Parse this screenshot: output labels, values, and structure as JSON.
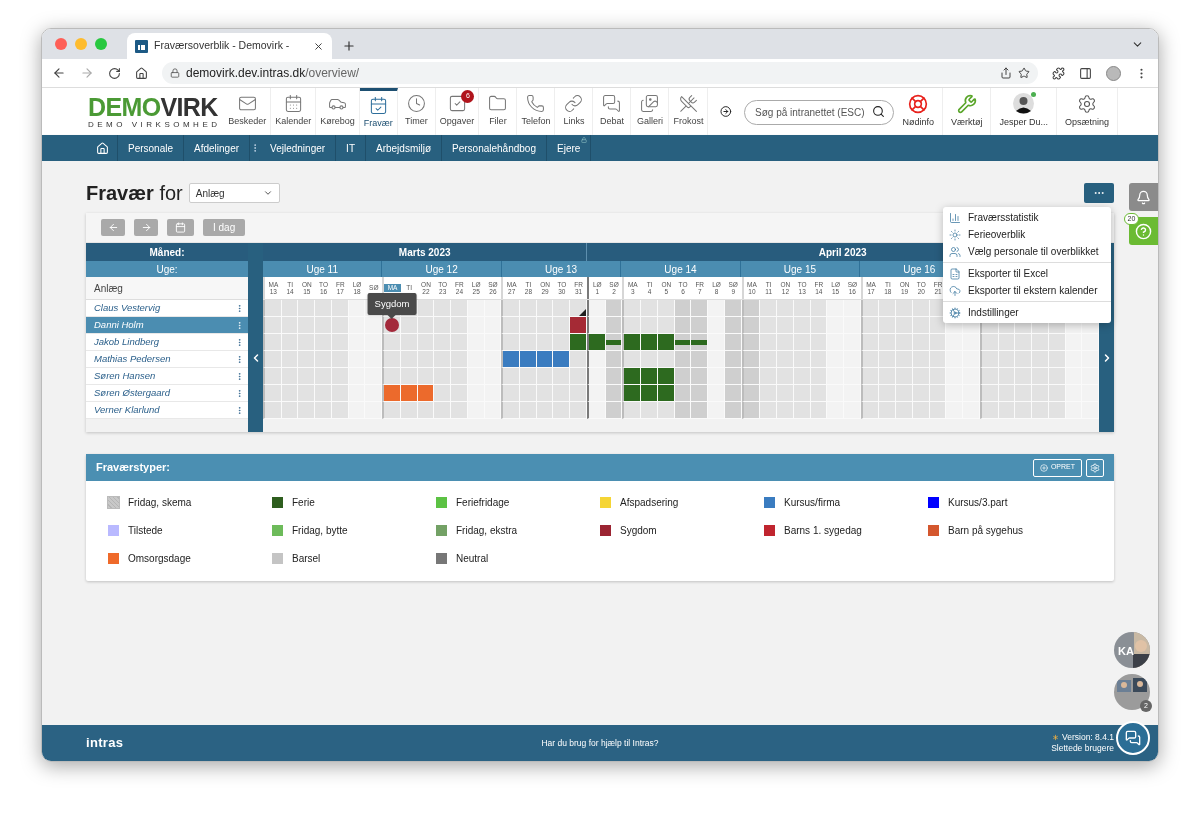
{
  "browser": {
    "tab_title": "Fraværsoverblik - Demovirk -",
    "url_host": "demovirk.dev.intras.dk",
    "url_path": "/overview/"
  },
  "header": {
    "logo": {
      "part_1": "DEMO",
      "part_2": "VIRK",
      "subtitle": "DEMO VIRKSOMHED"
    },
    "apps": [
      {
        "label": "Beskeder",
        "kind": "mail",
        "selected": false
      },
      {
        "label": "Kalender",
        "kind": "calendar",
        "selected": false
      },
      {
        "label": "Kørebog",
        "kind": "car",
        "selected": false
      },
      {
        "label": "Fravær",
        "kind": "absence",
        "selected": true
      },
      {
        "label": "Timer",
        "kind": "clock",
        "selected": false
      },
      {
        "label": "Opgaver",
        "kind": "tasks",
        "selected": false,
        "badge": "6"
      },
      {
        "label": "Filer",
        "kind": "folder",
        "selected": false
      },
      {
        "label": "Telefon",
        "kind": "phone",
        "selected": false
      },
      {
        "label": "Links",
        "kind": "link",
        "selected": false
      },
      {
        "label": "Debat",
        "kind": "chat",
        "selected": false
      },
      {
        "label": "Galleri",
        "kind": "gallery",
        "selected": false
      },
      {
        "label": "Frokost",
        "kind": "lunch",
        "selected": false
      }
    ],
    "search": {
      "placeholder": "Søg på intranettet (ESC)"
    },
    "tools": [
      {
        "label": "Nødinfo",
        "kind": "lifebuoy"
      },
      {
        "label": "Værktøj",
        "kind": "tools"
      },
      {
        "label": "Jesper Du...",
        "kind": "avatar",
        "online": true
      },
      {
        "label": "Opsætning",
        "kind": "cogs"
      }
    ]
  },
  "nav": [
    {
      "label": "Personale",
      "kind": "plain"
    },
    {
      "label": "Afdelinger",
      "kind": "more"
    },
    {
      "label": "Vejledninger",
      "kind": "plain"
    },
    {
      "label": "IT",
      "kind": "plain"
    },
    {
      "label": "Arbejdsmiljø",
      "kind": "plain"
    },
    {
      "label": "Personalehåndbog",
      "kind": "plain"
    },
    {
      "label": "Ejere",
      "kind": "locked"
    }
  ],
  "page": {
    "title": "Fravær",
    "title_suffix": "for",
    "department": "Anlæg"
  },
  "toolbar": {
    "today": "I dag"
  },
  "calendar": {
    "month_heading": "Måned:",
    "week_heading": "Uge:",
    "group": "Anlæg",
    "months": [
      "Marts 2023",
      "April 2023"
    ],
    "weeks": [
      "Uge 11",
      "Uge 12",
      "Uge 13",
      "Uge 14",
      "Uge 15",
      "Uge 16"
    ],
    "days": [
      {
        "dow": "MA",
        "date": "13",
        "kind": "weekday",
        "week_start": true,
        "month_start": false,
        "highlighted": false
      },
      {
        "dow": "TI",
        "date": "14",
        "kind": "weekday",
        "week_start": false,
        "month_start": false,
        "highlighted": false
      },
      {
        "dow": "ON",
        "date": "15",
        "kind": "weekday",
        "week_start": false,
        "month_start": false,
        "highlighted": false
      },
      {
        "dow": "TO",
        "date": "16",
        "kind": "weekday",
        "week_start": false,
        "month_start": false,
        "highlighted": false
      },
      {
        "dow": "FR",
        "date": "17",
        "kind": "weekday",
        "week_start": false,
        "month_start": false,
        "highlighted": false
      },
      {
        "dow": "LØ",
        "date": "18",
        "kind": "weekend",
        "week_start": false,
        "month_start": false,
        "highlighted": false
      },
      {
        "dow": "SØ",
        "kind": "weekend",
        "week_start": false,
        "month_start": false,
        "highlighted": false
      },
      {
        "dow": "MA",
        "kind": "weekday",
        "week_start": true,
        "month_start": false,
        "highlighted": true
      },
      {
        "dow": "TI",
        "kind": "weekday",
        "week_start": false,
        "month_start": false,
        "highlighted": false
      },
      {
        "dow": "ON",
        "date": "22",
        "kind": "weekday",
        "week_start": false,
        "month_start": false,
        "highlighted": false
      },
      {
        "dow": "TO",
        "date": "23",
        "kind": "weekday",
        "week_start": false,
        "month_start": false,
        "highlighted": false
      },
      {
        "dow": "FR",
        "date": "24",
        "kind": "weekday",
        "week_start": false,
        "month_start": false,
        "highlighted": false
      },
      {
        "dow": "LØ",
        "date": "25",
        "kind": "weekend",
        "week_start": false,
        "month_start": false,
        "highlighted": false
      },
      {
        "dow": "SØ",
        "date": "26",
        "kind": "weekend",
        "week_start": false,
        "month_start": false,
        "highlighted": false
      },
      {
        "dow": "MA",
        "date": "27",
        "kind": "weekday",
        "week_start": true,
        "month_start": false,
        "highlighted": false
      },
      {
        "dow": "TI",
        "date": "28",
        "kind": "weekday",
        "week_start": false,
        "month_start": false,
        "highlighted": false
      },
      {
        "dow": "ON",
        "date": "29",
        "kind": "weekday",
        "week_start": false,
        "month_start": false,
        "highlighted": false
      },
      {
        "dow": "TO",
        "date": "30",
        "kind": "weekday",
        "week_start": false,
        "month_start": false,
        "highlighted": false
      },
      {
        "dow": "FR",
        "date": "31",
        "kind": "weekday",
        "week_start": false,
        "month_start": false,
        "highlighted": false
      },
      {
        "dow": "LØ",
        "date": "1",
        "kind": "weekend",
        "week_start": false,
        "month_start": true,
        "highlighted": false
      },
      {
        "dow": "SØ",
        "date": "2",
        "kind": "holiday",
        "week_start": false,
        "month_start": false,
        "highlighted": false
      },
      {
        "dow": "MA",
        "date": "3",
        "kind": "weekday",
        "week_start": true,
        "month_start": false,
        "highlighted": false
      },
      {
        "dow": "TI",
        "date": "4",
        "kind": "weekday",
        "week_start": false,
        "month_start": false,
        "highlighted": false
      },
      {
        "dow": "ON",
        "date": "5",
        "kind": "weekday",
        "week_start": false,
        "month_start": false,
        "highlighted": false
      },
      {
        "dow": "TO",
        "date": "6",
        "kind": "holiday",
        "week_start": false,
        "month_start": false,
        "highlighted": false
      },
      {
        "dow": "FR",
        "date": "7",
        "kind": "holiday",
        "week_start": false,
        "month_start": false,
        "highlighted": false
      },
      {
        "dow": "LØ",
        "date": "8",
        "kind": "weekend",
        "week_start": false,
        "month_start": false,
        "highlighted": false
      },
      {
        "dow": "SØ",
        "date": "9",
        "kind": "holiday",
        "week_start": false,
        "month_start": false,
        "highlighted": false
      },
      {
        "dow": "MA",
        "date": "10",
        "kind": "holiday",
        "week_start": true,
        "month_start": false,
        "highlighted": false
      },
      {
        "dow": "TI",
        "date": "11",
        "kind": "weekday",
        "week_start": false,
        "month_start": false,
        "highlighted": false
      },
      {
        "dow": "ON",
        "date": "12",
        "kind": "weekday",
        "week_start": false,
        "month_start": false,
        "highlighted": false
      },
      {
        "dow": "TO",
        "date": "13",
        "kind": "weekday",
        "week_start": false,
        "month_start": false,
        "highlighted": false
      },
      {
        "dow": "FR",
        "date": "14",
        "kind": "weekday",
        "week_start": false,
        "month_start": false,
        "highlighted": false
      },
      {
        "dow": "LØ",
        "date": "15",
        "kind": "weekend",
        "week_start": false,
        "month_start": false,
        "highlighted": false
      },
      {
        "dow": "SØ",
        "date": "16",
        "kind": "weekend",
        "week_start": false,
        "month_start": false,
        "highlighted": false
      },
      {
        "dow": "MA",
        "date": "17",
        "kind": "weekday",
        "week_start": true,
        "month_start": false,
        "highlighted": false
      },
      {
        "dow": "TI",
        "date": "18",
        "kind": "weekday",
        "week_start": false,
        "month_start": false,
        "highlighted": false
      },
      {
        "dow": "ON",
        "date": "19",
        "kind": "weekday",
        "week_start": false,
        "month_start": false,
        "highlighted": false
      },
      {
        "dow": "TO",
        "date": "20",
        "kind": "weekday",
        "week_start": false,
        "month_start": false,
        "highlighted": false
      },
      {
        "dow": "FR",
        "date": "21",
        "kind": "weekday",
        "week_start": false,
        "month_start": false,
        "highlighted": false
      },
      {
        "kind": "weekend",
        "week_start": false,
        "month_start": false
      },
      {
        "kind": "weekend",
        "week_start": false,
        "month_start": false
      },
      {
        "kind": "weekday",
        "week_start": true,
        "month_start": false
      },
      {
        "kind": "weekday",
        "week_start": false,
        "month_start": false
      },
      {
        "kind": "weekday",
        "week_start": false,
        "month_start": false
      },
      {
        "kind": "weekday",
        "week_start": false,
        "month_start": false
      },
      {
        "kind": "weekday",
        "week_start": false,
        "month_start": false
      },
      {
        "kind": "weekend",
        "week_start": false,
        "month_start": false
      },
      {
        "kind": "weekend",
        "week_start": false,
        "month_start": false
      }
    ],
    "employees": [
      {
        "name": "Claus Vestervig",
        "selected": false,
        "cells": [
          {
            "kind": "none"
          },
          {
            "kind": "none"
          },
          {
            "kind": "none"
          },
          {
            "kind": "none"
          },
          {
            "kind": "none"
          },
          {
            "kind": "none"
          },
          {
            "kind": "none"
          },
          {
            "kind": "none"
          },
          {
            "kind": "none"
          },
          {
            "kind": "none"
          },
          {
            "kind": "none"
          },
          {
            "kind": "none"
          },
          {
            "kind": "none"
          },
          {
            "kind": "none"
          },
          {
            "kind": "none"
          },
          {
            "kind": "none"
          },
          {
            "kind": "none"
          },
          {
            "kind": "none"
          },
          {
            "kind": "marker",
            "color": "#1f1f1f"
          },
          {
            "kind": "none"
          },
          {
            "kind": "none"
          },
          {
            "kind": "none"
          },
          {
            "kind": "none"
          },
          {
            "kind": "none"
          },
          {
            "kind": "none"
          },
          {
            "kind": "none"
          },
          {
            "kind": "none"
          },
          {
            "kind": "none"
          },
          {
            "kind": "none"
          },
          {
            "kind": "none"
          },
          {
            "kind": "none"
          },
          {
            "kind": "none"
          },
          {
            "kind": "none"
          },
          {
            "kind": "none"
          },
          {
            "kind": "none"
          },
          {
            "kind": "none"
          },
          {
            "kind": "none"
          },
          {
            "kind": "none"
          },
          {
            "kind": "none"
          },
          {
            "kind": "none"
          },
          {
            "kind": "none"
          },
          {
            "kind": "none"
          },
          {
            "kind": "none"
          },
          {
            "kind": "none"
          },
          {
            "kind": "none"
          },
          {
            "kind": "none"
          },
          {
            "kind": "none"
          },
          {
            "kind": "none"
          },
          {
            "kind": "none"
          }
        ]
      },
      {
        "name": "Danni Holm",
        "selected": true,
        "cells": [
          {
            "kind": "none"
          },
          {
            "kind": "none"
          },
          {
            "kind": "none"
          },
          {
            "kind": "none"
          },
          {
            "kind": "none"
          },
          {
            "kind": "none"
          },
          {
            "kind": "none"
          },
          {
            "kind": "dot",
            "color": "#a3283a",
            "tooltip": "Sygdom"
          },
          {
            "kind": "none"
          },
          {
            "kind": "none"
          },
          {
            "kind": "none"
          },
          {
            "kind": "none"
          },
          {
            "kind": "none"
          },
          {
            "kind": "none"
          },
          {
            "kind": "none"
          },
          {
            "kind": "none"
          },
          {
            "kind": "none"
          },
          {
            "kind": "none"
          },
          {
            "kind": "full",
            "color": "#a52a35"
          },
          {
            "kind": "none"
          },
          {
            "kind": "none"
          },
          {
            "kind": "none"
          },
          {
            "kind": "none"
          },
          {
            "kind": "none"
          },
          {
            "kind": "none"
          },
          {
            "kind": "none"
          },
          {
            "kind": "none"
          },
          {
            "kind": "none"
          },
          {
            "kind": "none"
          },
          {
            "kind": "none"
          },
          {
            "kind": "none"
          },
          {
            "kind": "none"
          },
          {
            "kind": "none"
          },
          {
            "kind": "none"
          },
          {
            "kind": "none"
          },
          {
            "kind": "none"
          },
          {
            "kind": "none"
          },
          {
            "kind": "none"
          },
          {
            "kind": "none"
          },
          {
            "kind": "none"
          },
          {
            "kind": "none"
          },
          {
            "kind": "none"
          },
          {
            "kind": "none"
          },
          {
            "kind": "none"
          },
          {
            "kind": "none"
          },
          {
            "kind": "none"
          },
          {
            "kind": "none"
          },
          {
            "kind": "none"
          },
          {
            "kind": "none"
          }
        ]
      },
      {
        "name": "Jakob Lindberg",
        "selected": false,
        "cells": [
          {
            "kind": "none"
          },
          {
            "kind": "none"
          },
          {
            "kind": "none"
          },
          {
            "kind": "none"
          },
          {
            "kind": "none"
          },
          {
            "kind": "none"
          },
          {
            "kind": "none"
          },
          {
            "kind": "none"
          },
          {
            "kind": "none"
          },
          {
            "kind": "none"
          },
          {
            "kind": "none"
          },
          {
            "kind": "none"
          },
          {
            "kind": "none"
          },
          {
            "kind": "none"
          },
          {
            "kind": "none"
          },
          {
            "kind": "none"
          },
          {
            "kind": "none"
          },
          {
            "kind": "none"
          },
          {
            "kind": "full",
            "color": "#2d6a1f"
          },
          {
            "kind": "full",
            "color": "#2d6a1f"
          },
          {
            "kind": "half",
            "color": "#2d6a1f"
          },
          {
            "kind": "full",
            "color": "#2d6a1f"
          },
          {
            "kind": "full",
            "color": "#2d6a1f"
          },
          {
            "kind": "full",
            "color": "#2d6a1f"
          },
          {
            "kind": "half",
            "color": "#2d6a1f"
          },
          {
            "kind": "half",
            "color": "#2d6a1f"
          },
          {
            "kind": "none"
          },
          {
            "kind": "none"
          },
          {
            "kind": "none"
          },
          {
            "kind": "none"
          },
          {
            "kind": "none"
          },
          {
            "kind": "none"
          },
          {
            "kind": "none"
          },
          {
            "kind": "none"
          },
          {
            "kind": "none"
          },
          {
            "kind": "none"
          },
          {
            "kind": "none"
          },
          {
            "kind": "none"
          },
          {
            "kind": "none"
          },
          {
            "kind": "none"
          },
          {
            "kind": "none"
          },
          {
            "kind": "none"
          },
          {
            "kind": "none"
          },
          {
            "kind": "none"
          },
          {
            "kind": "none"
          },
          {
            "kind": "none"
          },
          {
            "kind": "none"
          },
          {
            "kind": "none"
          },
          {
            "kind": "none"
          }
        ]
      },
      {
        "name": "Mathias Pedersen",
        "selected": false,
        "cells": [
          {
            "kind": "none"
          },
          {
            "kind": "none"
          },
          {
            "kind": "none"
          },
          {
            "kind": "none"
          },
          {
            "kind": "none"
          },
          {
            "kind": "none"
          },
          {
            "kind": "none"
          },
          {
            "kind": "none"
          },
          {
            "kind": "none"
          },
          {
            "kind": "none"
          },
          {
            "kind": "none"
          },
          {
            "kind": "none"
          },
          {
            "kind": "none"
          },
          {
            "kind": "none"
          },
          {
            "kind": "full",
            "color": "#3a7cc0"
          },
          {
            "kind": "full",
            "color": "#3a7cc0"
          },
          {
            "kind": "full",
            "color": "#3a7cc0"
          },
          {
            "kind": "full",
            "color": "#3a7cc0"
          },
          {
            "kind": "none"
          },
          {
            "kind": "none"
          },
          {
            "kind": "none"
          },
          {
            "kind": "none"
          },
          {
            "kind": "none"
          },
          {
            "kind": "none"
          },
          {
            "kind": "none"
          },
          {
            "kind": "none"
          },
          {
            "kind": "none"
          },
          {
            "kind": "none"
          },
          {
            "kind": "none"
          },
          {
            "kind": "none"
          },
          {
            "kind": "none"
          },
          {
            "kind": "none"
          },
          {
            "kind": "none"
          },
          {
            "kind": "none"
          },
          {
            "kind": "none"
          },
          {
            "kind": "none"
          },
          {
            "kind": "none"
          },
          {
            "kind": "none"
          },
          {
            "kind": "none"
          },
          {
            "kind": "none"
          },
          {
            "kind": "none"
          },
          {
            "kind": "none"
          },
          {
            "kind": "none"
          },
          {
            "kind": "none"
          },
          {
            "kind": "none"
          },
          {
            "kind": "none"
          },
          {
            "kind": "none"
          },
          {
            "kind": "none"
          },
          {
            "kind": "none"
          }
        ]
      },
      {
        "name": "Søren Hansen",
        "selected": false,
        "cells": [
          {
            "kind": "none"
          },
          {
            "kind": "none"
          },
          {
            "kind": "none"
          },
          {
            "kind": "none"
          },
          {
            "kind": "none"
          },
          {
            "kind": "none"
          },
          {
            "kind": "none"
          },
          {
            "kind": "none"
          },
          {
            "kind": "none"
          },
          {
            "kind": "none"
          },
          {
            "kind": "none"
          },
          {
            "kind": "none"
          },
          {
            "kind": "none"
          },
          {
            "kind": "none"
          },
          {
            "kind": "none"
          },
          {
            "kind": "none"
          },
          {
            "kind": "none"
          },
          {
            "kind": "none"
          },
          {
            "kind": "none"
          },
          {
            "kind": "none"
          },
          {
            "kind": "none"
          },
          {
            "kind": "full",
            "color": "#2d6a1f"
          },
          {
            "kind": "full",
            "color": "#2d6a1f"
          },
          {
            "kind": "full",
            "color": "#2d6a1f"
          },
          {
            "kind": "none"
          },
          {
            "kind": "none"
          },
          {
            "kind": "none"
          },
          {
            "kind": "none"
          },
          {
            "kind": "none"
          },
          {
            "kind": "none"
          },
          {
            "kind": "none"
          },
          {
            "kind": "none"
          },
          {
            "kind": "none"
          },
          {
            "kind": "none"
          },
          {
            "kind": "none"
          },
          {
            "kind": "none"
          },
          {
            "kind": "none"
          },
          {
            "kind": "none"
          },
          {
            "kind": "none"
          },
          {
            "kind": "none"
          },
          {
            "kind": "none"
          },
          {
            "kind": "none"
          },
          {
            "kind": "none"
          },
          {
            "kind": "none"
          },
          {
            "kind": "none"
          },
          {
            "kind": "none"
          },
          {
            "kind": "none"
          },
          {
            "kind": "none"
          },
          {
            "kind": "none"
          }
        ]
      },
      {
        "name": "Søren Østergaard",
        "selected": false,
        "cells": [
          {
            "kind": "none"
          },
          {
            "kind": "none"
          },
          {
            "kind": "none"
          },
          {
            "kind": "none"
          },
          {
            "kind": "none"
          },
          {
            "kind": "none"
          },
          {
            "kind": "none"
          },
          {
            "kind": "full",
            "color": "#ec6a2c"
          },
          {
            "kind": "full",
            "color": "#ec6a2c"
          },
          {
            "kind": "full",
            "color": "#ec6a2c"
          },
          {
            "kind": "none"
          },
          {
            "kind": "none"
          },
          {
            "kind": "none"
          },
          {
            "kind": "none"
          },
          {
            "kind": "none"
          },
          {
            "kind": "none"
          },
          {
            "kind": "none"
          },
          {
            "kind": "none"
          },
          {
            "kind": "none"
          },
          {
            "kind": "none"
          },
          {
            "kind": "none"
          },
          {
            "kind": "full",
            "color": "#2d6a1f"
          },
          {
            "kind": "full",
            "color": "#2d6a1f"
          },
          {
            "kind": "full",
            "color": "#2d6a1f"
          },
          {
            "kind": "none"
          },
          {
            "kind": "none"
          },
          {
            "kind": "none"
          },
          {
            "kind": "none"
          },
          {
            "kind": "none"
          },
          {
            "kind": "none"
          },
          {
            "kind": "none"
          },
          {
            "kind": "none"
          },
          {
            "kind": "none"
          },
          {
            "kind": "none"
          },
          {
            "kind": "none"
          },
          {
            "kind": "none"
          },
          {
            "kind": "none"
          },
          {
            "kind": "none"
          },
          {
            "kind": "none"
          },
          {
            "kind": "none"
          },
          {
            "kind": "none"
          },
          {
            "kind": "none"
          },
          {
            "kind": "none"
          },
          {
            "kind": "none"
          },
          {
            "kind": "none"
          },
          {
            "kind": "none"
          },
          {
            "kind": "none"
          },
          {
            "kind": "none"
          },
          {
            "kind": "none"
          }
        ]
      },
      {
        "name": "Verner Klarlund",
        "selected": false,
        "cells": [
          {
            "kind": "none"
          },
          {
            "kind": "none"
          },
          {
            "kind": "none"
          },
          {
            "kind": "none"
          },
          {
            "kind": "none"
          },
          {
            "kind": "none"
          },
          {
            "kind": "none"
          },
          {
            "kind": "none"
          },
          {
            "kind": "none"
          },
          {
            "kind": "none"
          },
          {
            "kind": "none"
          },
          {
            "kind": "none"
          },
          {
            "kind": "none"
          },
          {
            "kind": "none"
          },
          {
            "kind": "none"
          },
          {
            "kind": "none"
          },
          {
            "kind": "none"
          },
          {
            "kind": "none"
          },
          {
            "kind": "none"
          },
          {
            "kind": "none"
          },
          {
            "kind": "none"
          },
          {
            "kind": "none"
          },
          {
            "kind": "none"
          },
          {
            "kind": "none"
          },
          {
            "kind": "none"
          },
          {
            "kind": "none"
          },
          {
            "kind": "none"
          },
          {
            "kind": "none"
          },
          {
            "kind": "none"
          },
          {
            "kind": "none"
          },
          {
            "kind": "none"
          },
          {
            "kind": "none"
          },
          {
            "kind": "none"
          },
          {
            "kind": "none"
          },
          {
            "kind": "none"
          },
          {
            "kind": "none"
          },
          {
            "kind": "none"
          },
          {
            "kind": "none"
          },
          {
            "kind": "none"
          },
          {
            "kind": "none"
          },
          {
            "kind": "none"
          },
          {
            "kind": "none"
          },
          {
            "kind": "none"
          },
          {
            "kind": "none"
          },
          {
            "kind": "none"
          },
          {
            "kind": "none"
          },
          {
            "kind": "none"
          },
          {
            "kind": "none"
          },
          {
            "kind": "none"
          }
        ]
      }
    ]
  },
  "menu": {
    "groups": [
      [
        {
          "label": "Fraværsstatistik",
          "kind": "stats"
        },
        {
          "label": "Ferieoverblik",
          "kind": "holiday"
        },
        {
          "label": "Vælg personale til overblikket",
          "kind": "staff"
        }
      ],
      [
        {
          "label": "Eksporter til Excel",
          "kind": "excel"
        },
        {
          "label": "Eksporter til ekstern kalender",
          "kind": "cloud"
        }
      ],
      [
        {
          "label": "Indstillinger",
          "kind": "settings"
        }
      ]
    ]
  },
  "legend": {
    "title": "Fraværstyper:",
    "create": "OPRET",
    "types": [
      {
        "label": "Fridag, skema",
        "color": "#c8c8c8",
        "kind": "hatched"
      },
      {
        "label": "Ferie",
        "color": "#2e5e1e",
        "kind": "solid"
      },
      {
        "label": "Feriefridage",
        "color": "#5cc244",
        "kind": "solid"
      },
      {
        "label": "Afspadsering",
        "color": "#f5d535",
        "kind": "solid"
      },
      {
        "label": "Kursus/firma",
        "color": "#3a7cc0",
        "kind": "solid"
      },
      {
        "label": "Kursus/3.part",
        "color": "#0000ff",
        "kind": "solid"
      },
      {
        "label": "Tilstede",
        "color": "#b9b9ff",
        "kind": "solid"
      },
      {
        "label": "Fridag, bytte",
        "color": "#6dbb5a",
        "kind": "solid"
      },
      {
        "label": "Fridag, ekstra",
        "color": "#73a165",
        "kind": "solid"
      },
      {
        "label": "Sygdom",
        "color": "#9b2432",
        "kind": "solid"
      },
      {
        "label": "Barns 1. sygedag",
        "color": "#c0252f",
        "kind": "solid"
      },
      {
        "label": "Barn på sygehus",
        "color": "#d4572e",
        "kind": "solid"
      },
      {
        "label": "Omsorgsdage",
        "color": "#ef6a2a",
        "kind": "solid"
      },
      {
        "label": "Barsel",
        "color": "#c4c4c4",
        "kind": "solid"
      },
      {
        "label": "Neutral",
        "color": "#777777",
        "kind": "solid"
      }
    ]
  },
  "side": {
    "help_badge": "20",
    "avatar_initials": "KA",
    "group_badge": "2"
  },
  "footer": {
    "brand": "intras",
    "help": "Har du brug for hjælp til Intras?",
    "version": "Version: 8.4.1",
    "deleted_users": "Slettede brugere"
  }
}
